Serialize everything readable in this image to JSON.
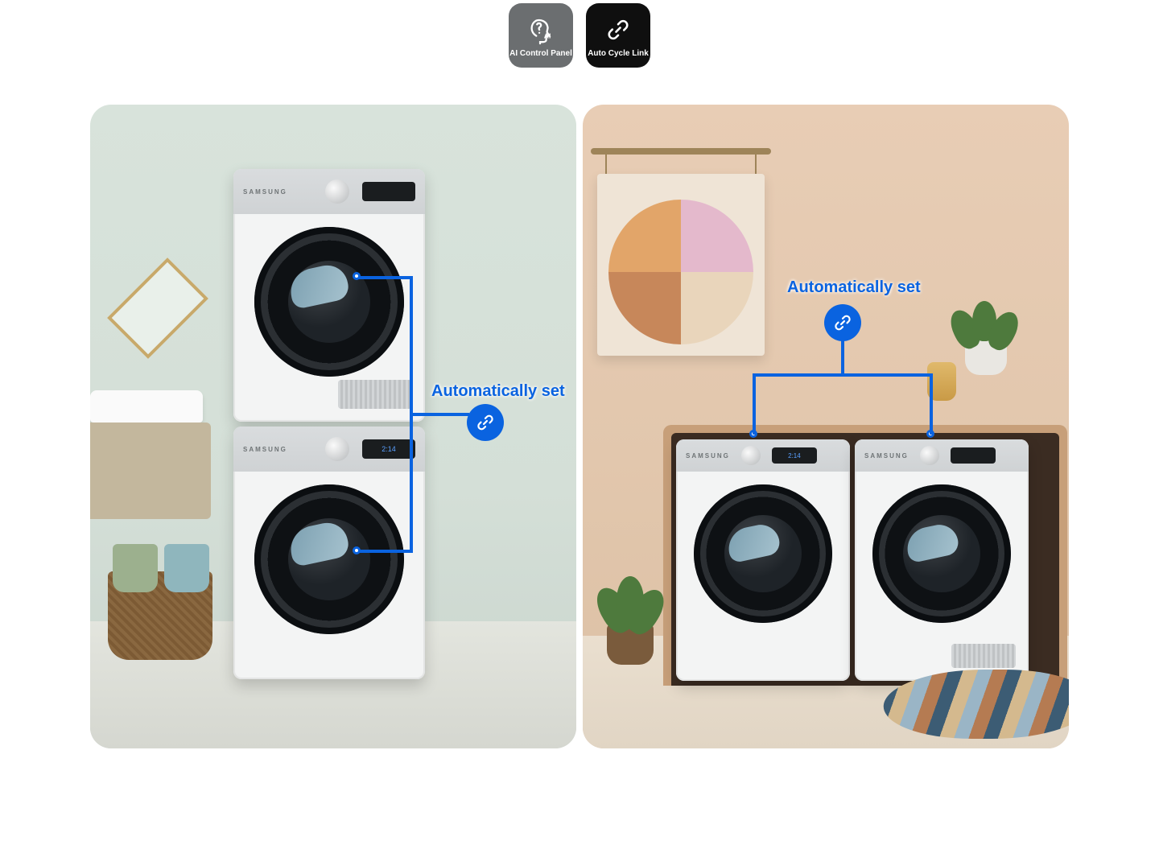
{
  "badges": {
    "ai": {
      "label": "AI Control Panel",
      "icon_name": "ai-head-icon"
    },
    "link": {
      "label": "Auto Cycle Link",
      "icon_name": "chain-link-icon"
    }
  },
  "overlay": {
    "label": "Automatically set",
    "link_icon_name": "chain-link-icon",
    "accent_color": "#0a63e0"
  },
  "appliance": {
    "brand": "SAMSUNG",
    "display": "2:14"
  }
}
